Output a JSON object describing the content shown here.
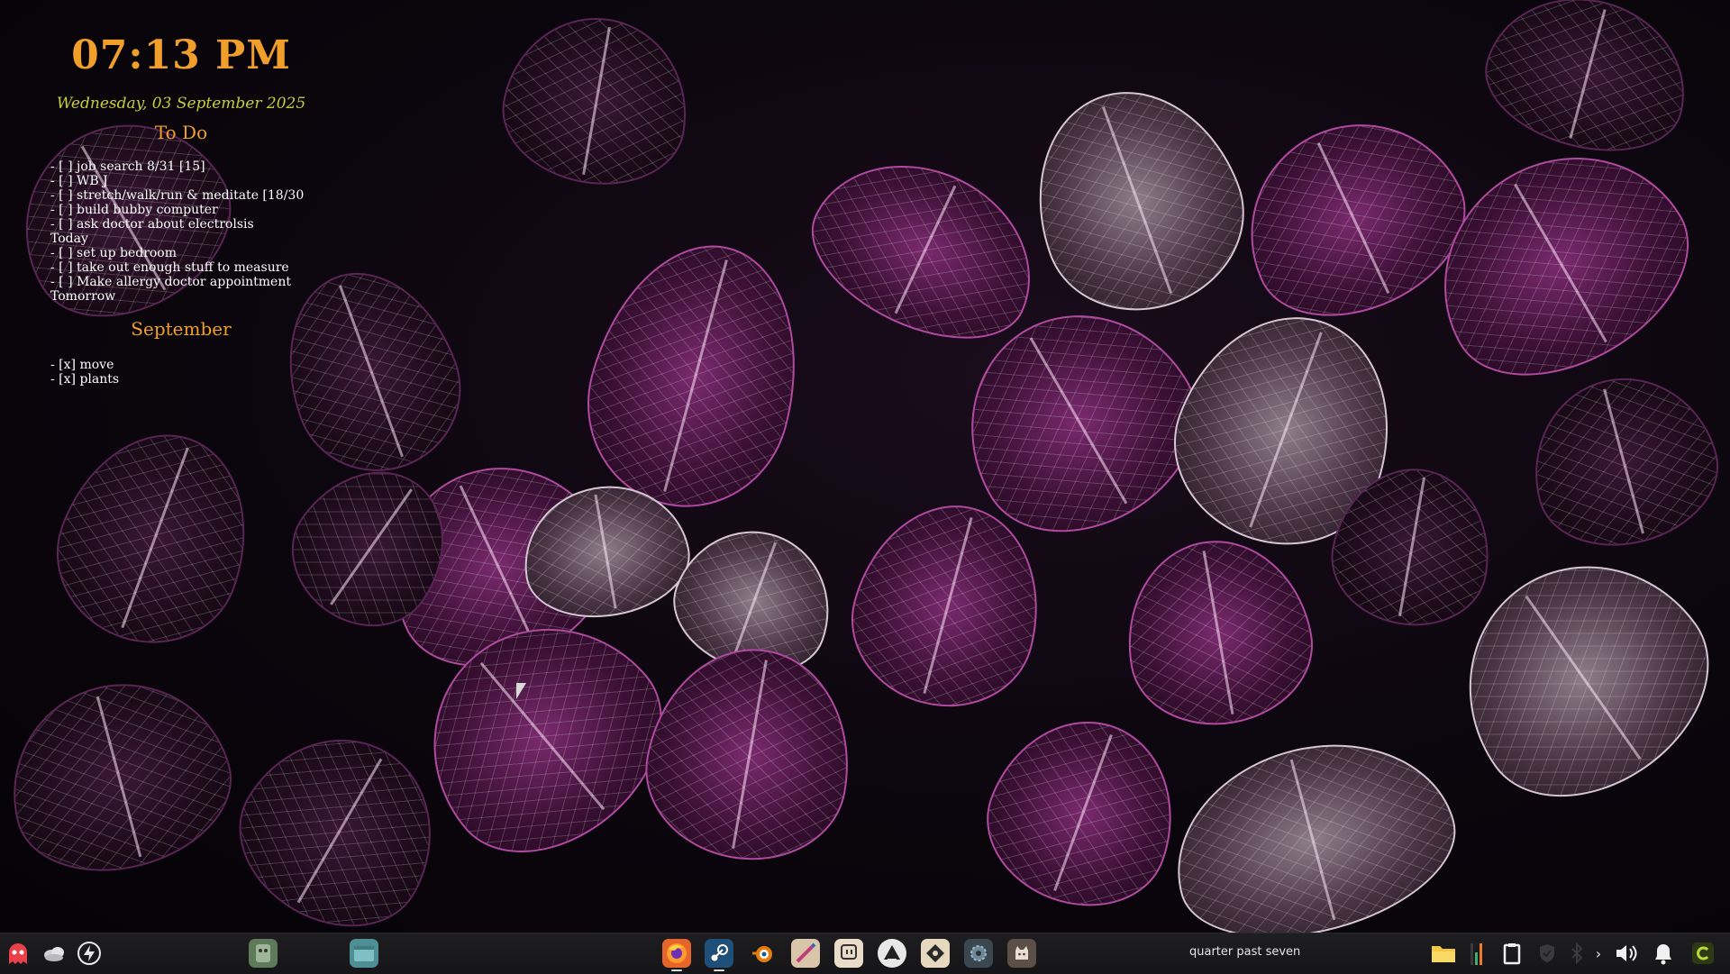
{
  "desktop": {
    "clock": "07:13 PM",
    "date": "Wednesday, 03 September 2025",
    "todo": {
      "title": "To Do",
      "lines": [
        "- [ ] job search 8/31 [15]",
        "- [ ] WB J",
        "- [ ] stretch/walk/run & meditate [18/30",
        "- [ ] build bubby computer",
        "- [ ] ask doctor about electrolsis",
        "Today",
        "- [ ] set up bedroom",
        "- [ ] take out enough stuff to measure",
        "- [ ] Make allergy doctor appointment",
        "Tomorrow"
      ]
    },
    "september": {
      "title": "September",
      "lines": [
        "- [x] move",
        "- [x] plants"
      ]
    }
  },
  "taskbar": {
    "left_icons": [
      "ghost-icon",
      "cloud-icon",
      "lightning-icon"
    ],
    "pinned_left": [
      "mascot-icon",
      "window-icon"
    ],
    "apps": [
      {
        "icon": "firefox-icon",
        "active": true
      },
      {
        "icon": "steam-icon",
        "active": true
      },
      {
        "icon": "blender-icon",
        "active": false
      },
      {
        "icon": "krita-icon",
        "active": false
      },
      {
        "icon": "twitch-icon",
        "active": false
      },
      {
        "icon": "inkscape-icon",
        "active": false
      },
      {
        "icon": "vpn-icon",
        "active": false
      },
      {
        "icon": "gear-icon",
        "active": false
      },
      {
        "icon": "cat-icon",
        "active": false
      }
    ],
    "status_text": "quarter past seven",
    "tray_icons": [
      "folder-icon",
      "audio-bars-icon",
      "clipboard-icon",
      "shield-icon",
      "bluetooth-icon",
      "chevron-right-icon",
      "speaker-icon",
      "bell-icon",
      "updates-icon"
    ],
    "colors": {
      "accent_orange": "#f0a02a",
      "date_yellow": "#c8cc3a"
    }
  }
}
